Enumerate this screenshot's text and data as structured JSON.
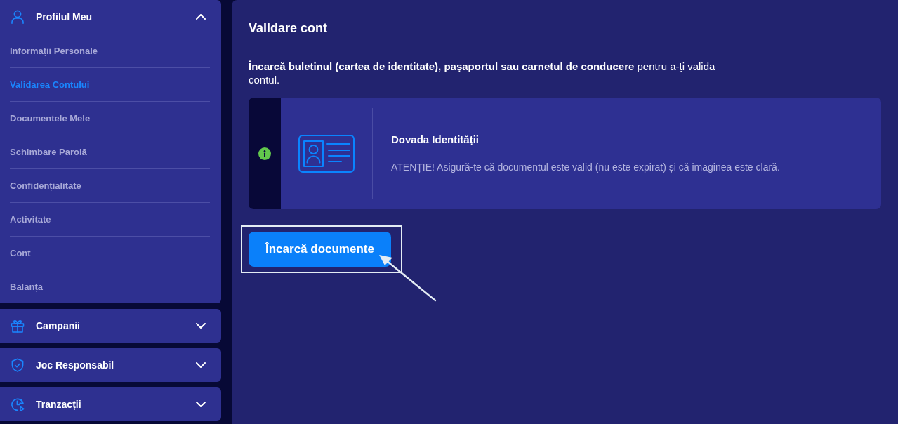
{
  "sidebar": {
    "sections": [
      {
        "title": "Profilul Meu",
        "expanded": true,
        "items": [
          {
            "label": "Informații Personale",
            "selected": false
          },
          {
            "label": "Validarea Contului",
            "selected": true
          },
          {
            "label": "Documentele Mele",
            "selected": false
          },
          {
            "label": "Schimbare Parolă",
            "selected": false
          },
          {
            "label": "Confidențialitate",
            "selected": false
          },
          {
            "label": "Activitate",
            "selected": false
          },
          {
            "label": "Cont",
            "selected": false
          },
          {
            "label": "Balanță",
            "selected": false
          }
        ]
      },
      {
        "title": "Campanii",
        "expanded": false
      },
      {
        "title": "Joc Responsabil",
        "expanded": false
      },
      {
        "title": "Tranzacții",
        "expanded": false
      }
    ]
  },
  "main": {
    "title": "Validare cont",
    "intro": "**Încarcă buletinul (cartea de identitate), pașaportul sau carnetul de conducere** pentru a-ți valida contul.",
    "notice": {
      "title": "Dovada Identității",
      "text": "ATENȚIE! Asigură-te că documentul este valid (nu este expirat) și că imaginea este clară."
    },
    "upload_button": {
      "label": "Încarcă documente",
      "highlighted": true
    }
  }
}
